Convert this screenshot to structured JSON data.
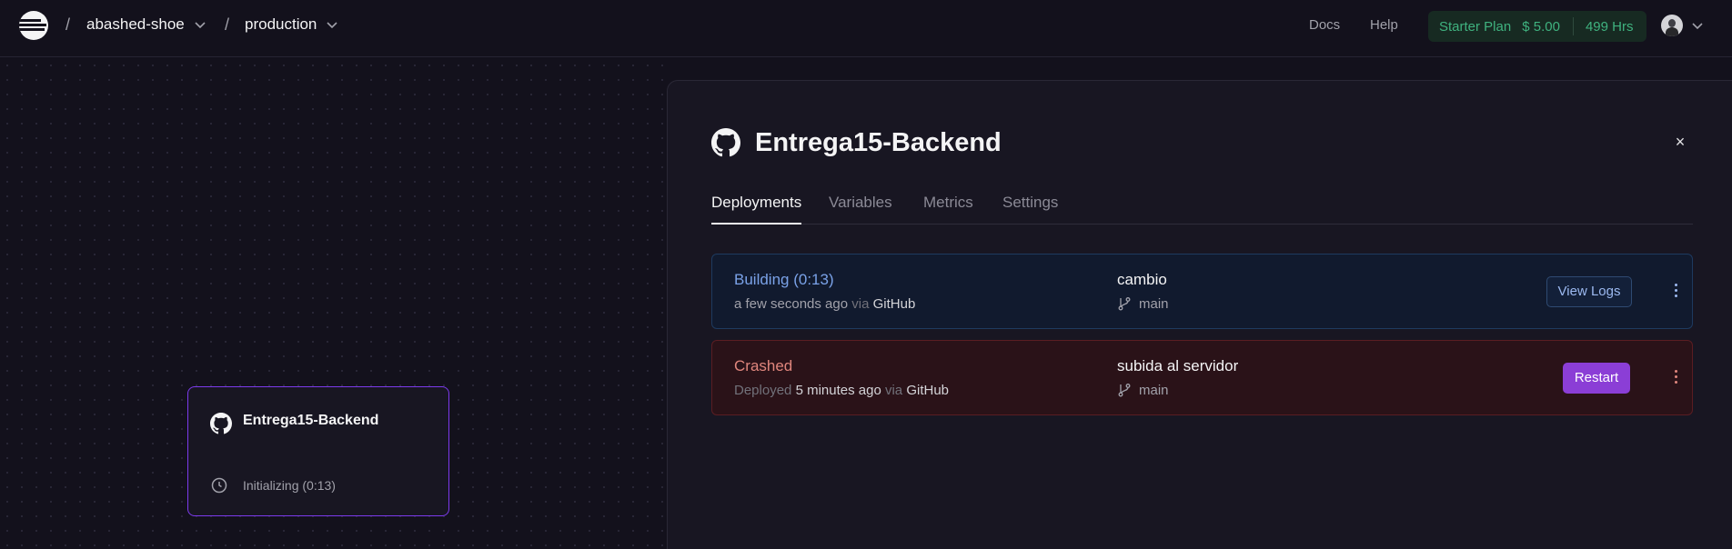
{
  "topbar": {
    "project": "abashed-shoe",
    "environment": "production",
    "separator": "/",
    "docs": "Docs",
    "help": "Help",
    "plan_name": "Starter Plan",
    "plan_cost": "$ 5.00",
    "plan_hours": "499 Hrs"
  },
  "canvas": {
    "service_name": "Entrega15-Backend",
    "service_status": "Initializing (0:13)"
  },
  "panel": {
    "title": "Entrega15-Backend",
    "close": "×",
    "tabs": [
      "Deployments",
      "Variables",
      "Metrics",
      "Settings"
    ],
    "deployments": [
      {
        "state": "Building (0:13)",
        "time": "a few seconds ago",
        "via": "via",
        "source": "GitHub",
        "message": "cambio",
        "branch": "main",
        "action": "View Logs"
      },
      {
        "state": "Crashed",
        "prefix": "Deployed",
        "time": "5 minutes ago",
        "via": "via",
        "source": "GitHub",
        "message": "subida al servidor",
        "branch": "main",
        "action": "Restart"
      }
    ]
  },
  "colors": {
    "accent_purple": "#8b3ed6",
    "building_blue": "#7aa2e8",
    "crashed_red": "#e0867d",
    "plan_green": "#3fb27f"
  }
}
